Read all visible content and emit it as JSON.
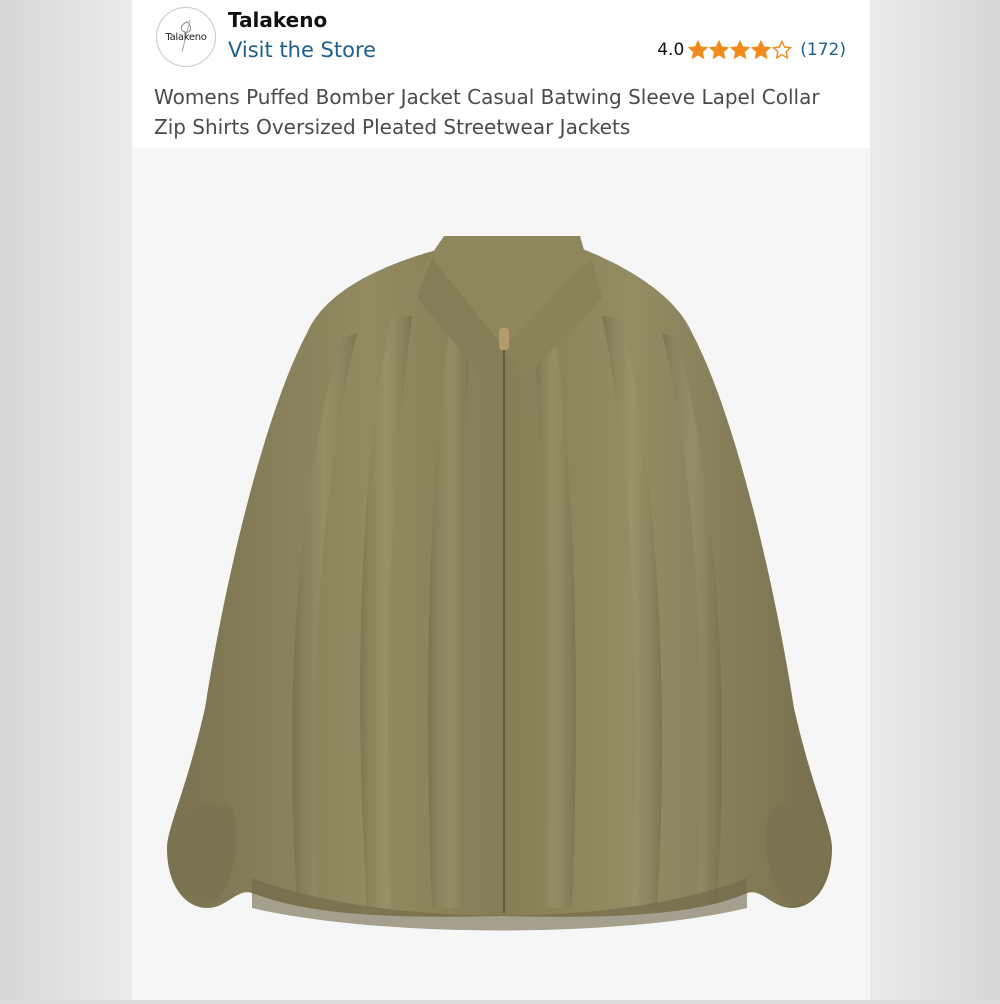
{
  "store": {
    "logo_text": "Talakeno",
    "brand": "Talakeno",
    "visit_link": "Visit the Store"
  },
  "rating": {
    "value": "4.0",
    "stars_filled": 4,
    "stars_total": 5,
    "count": "(172)"
  },
  "product": {
    "title": "Womens Puffed Bomber Jacket Casual Batwing Sleeve Lapel Collar Zip Shirts Oversized Pleated Streetwear Jackets",
    "image": "olive-green-puffed-bomber-jacket"
  },
  "colors": {
    "link": "#1f5f8b",
    "star": "#f08a1c",
    "jacket": "#8c8359"
  }
}
